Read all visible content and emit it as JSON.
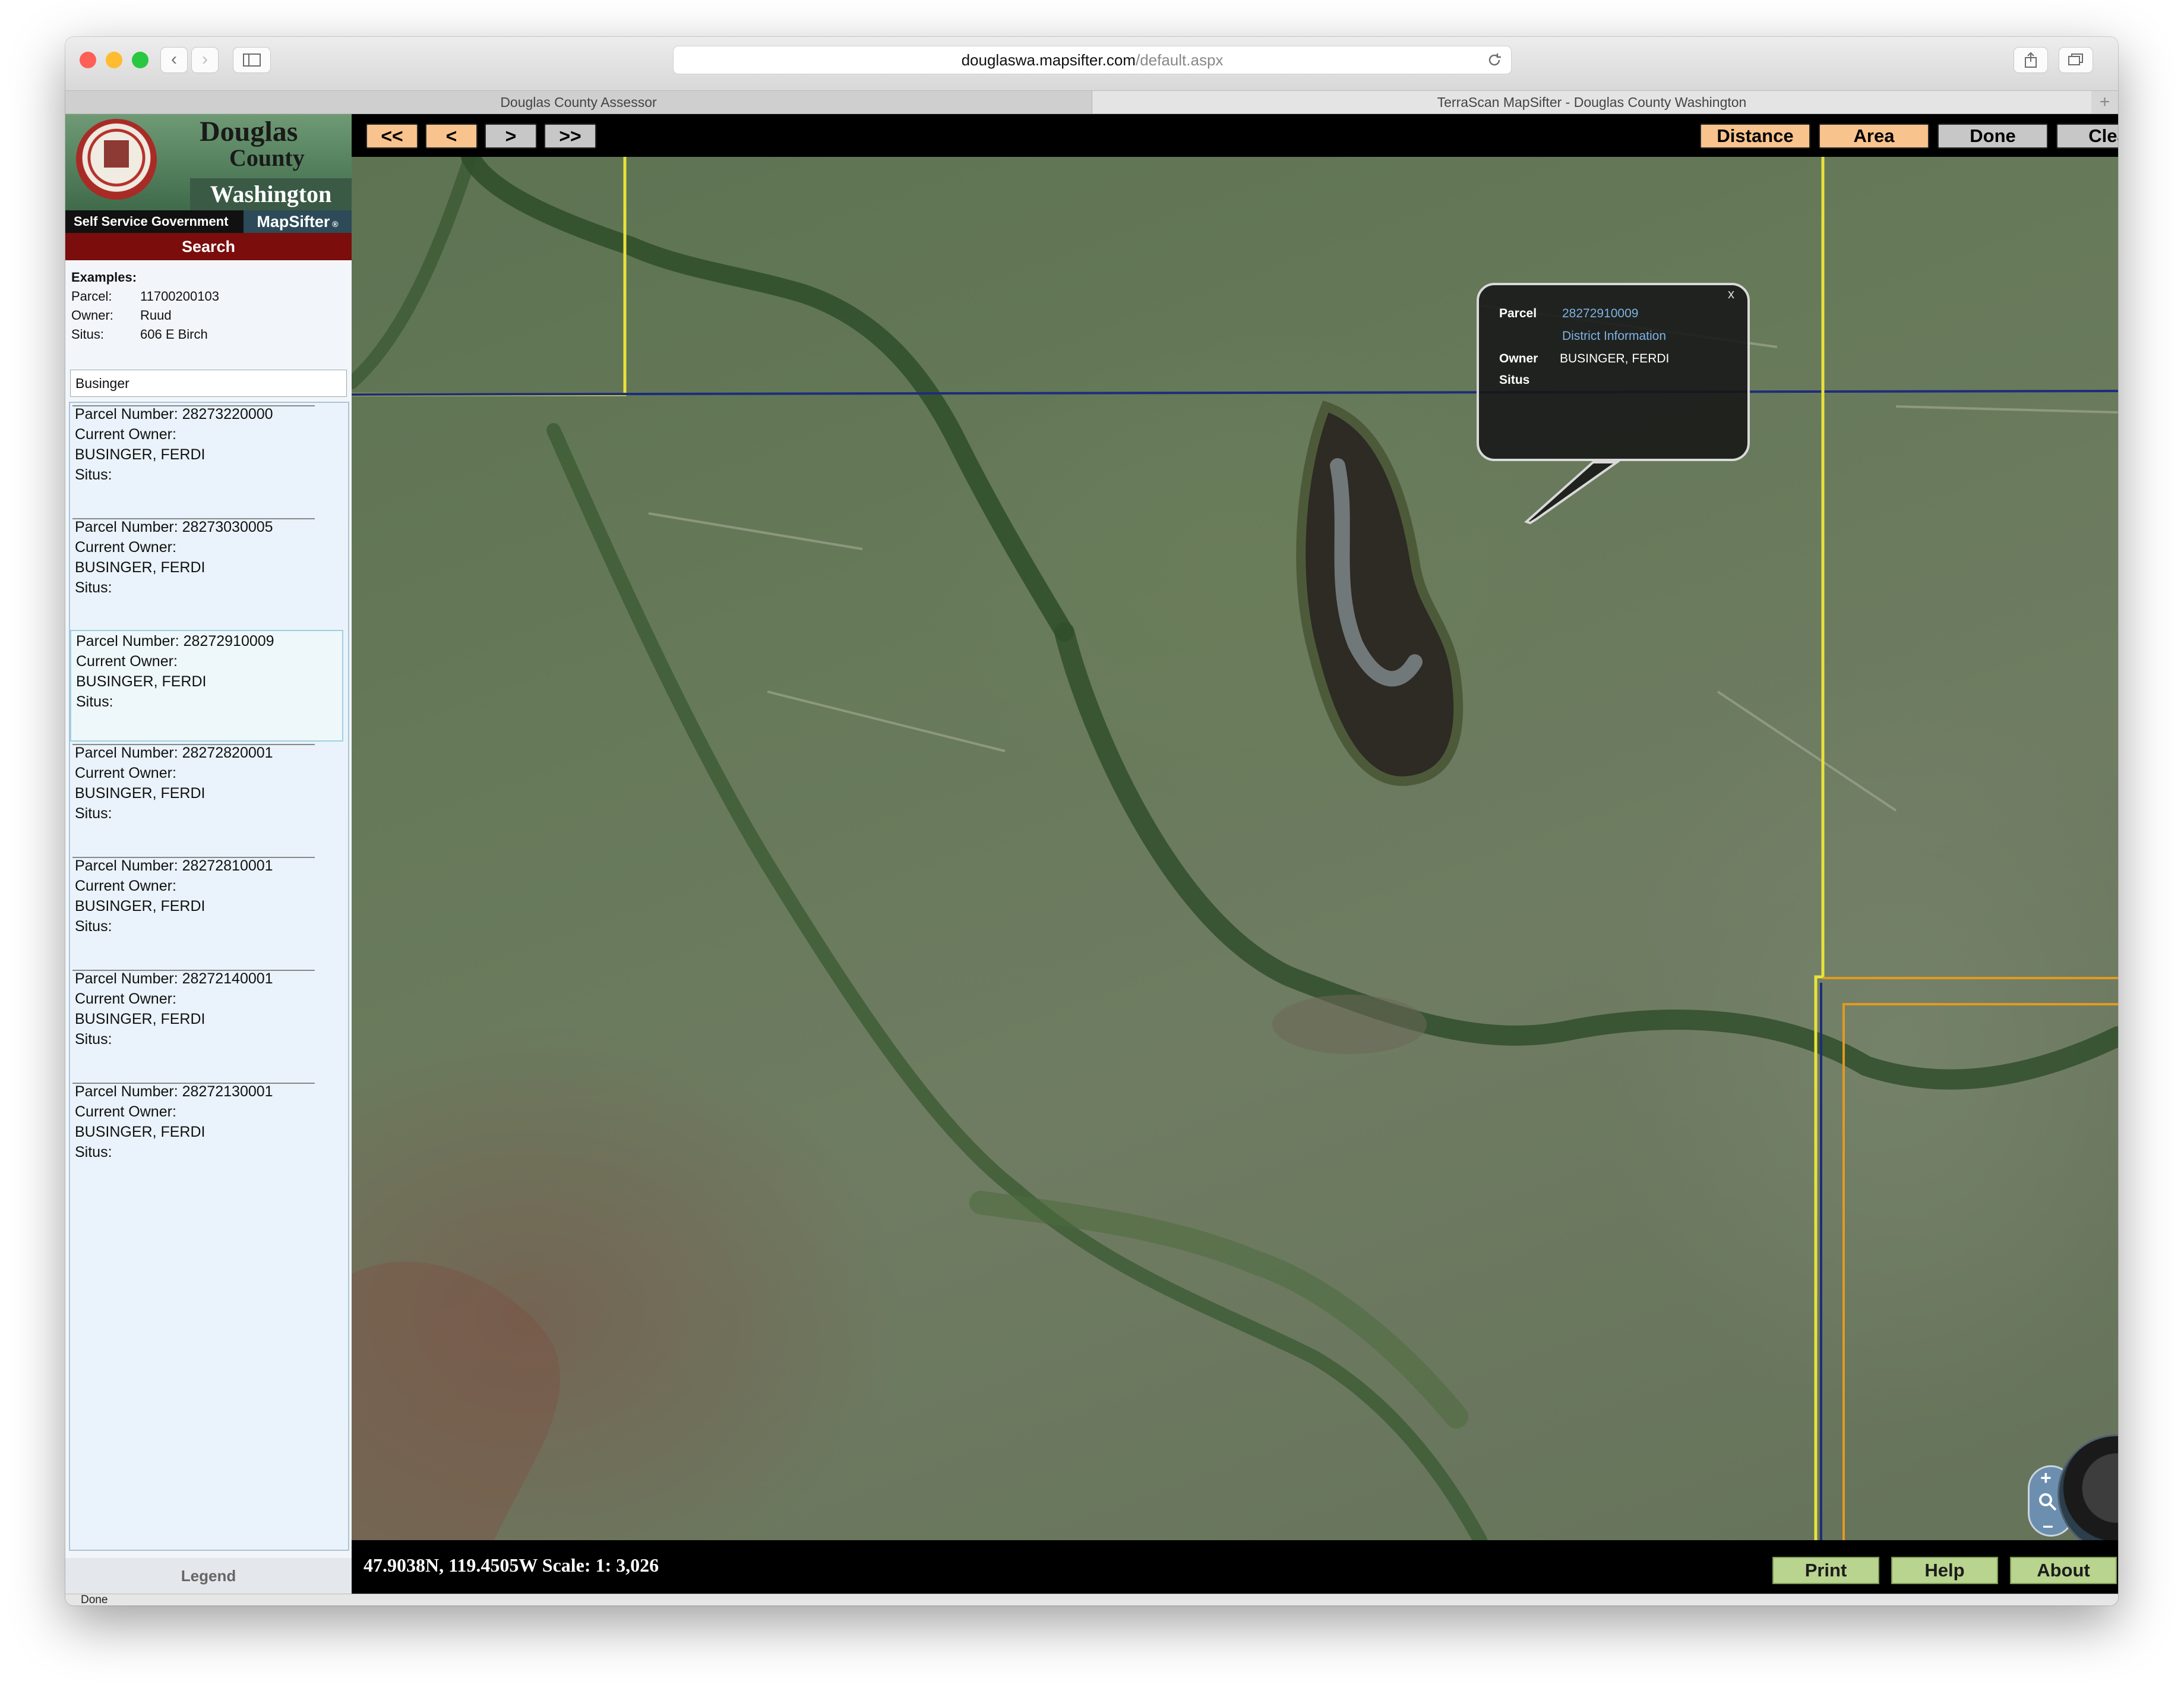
{
  "browser": {
    "url_domain": "douglaswa.mapsifter.com",
    "url_path": "/default.aspx",
    "tabs": [
      {
        "label": "Douglas County Assessor"
      },
      {
        "label": "TerraScan MapSifter - Douglas County Washington"
      }
    ],
    "status": "Done"
  },
  "logo": {
    "title_line1": "Douglas",
    "title_line2": "County",
    "title_line3": "Washington",
    "self_service": "Self Service Government",
    "mapsifter": "MapSifter"
  },
  "sidebar": {
    "search_header": "Search",
    "examples_title": "Examples:",
    "examples": [
      {
        "label": "Parcel:",
        "value": "11700200103"
      },
      {
        "label": "Owner:",
        "value": "Ruud"
      },
      {
        "label": "Situs:",
        "value": "606 E Birch"
      }
    ],
    "search_value": "Businger",
    "legend": "Legend"
  },
  "results": [
    {
      "parcel_line": "Parcel Number: 28273220000",
      "owner_label": "Current Owner:",
      "owner": "BUSINGER, FERDI",
      "situs_label": "Situs:"
    },
    {
      "parcel_line": "Parcel Number: 28273030005",
      "owner_label": "Current Owner:",
      "owner": "BUSINGER, FERDI",
      "situs_label": "Situs:"
    },
    {
      "parcel_line": "Parcel Number: 28272910009",
      "owner_label": "Current Owner:",
      "owner": "BUSINGER, FERDI",
      "situs_label": "Situs:",
      "selected": true
    },
    {
      "parcel_line": "Parcel Number: 28272820001",
      "owner_label": "Current Owner:",
      "owner": "BUSINGER, FERDI",
      "situs_label": "Situs:"
    },
    {
      "parcel_line": "Parcel Number: 28272810001",
      "owner_label": "Current Owner:",
      "owner": "BUSINGER, FERDI",
      "situs_label": "Situs:"
    },
    {
      "parcel_line": "Parcel Number: 28272140001",
      "owner_label": "Current Owner:",
      "owner": "BUSINGER, FERDI",
      "situs_label": "Situs:"
    },
    {
      "parcel_line": "Parcel Number: 28272130001",
      "owner_label": "Current Owner:",
      "owner": "BUSINGER, FERDI",
      "situs_label": "Situs:"
    }
  ],
  "toolbar": {
    "first": "<<",
    "prev": "<",
    "next": ">",
    "last": ">>",
    "distance": "Distance",
    "area": "Area",
    "done": "Done",
    "clear": "Clear"
  },
  "popup": {
    "close": "x",
    "parcel_label": "Parcel",
    "parcel_value": "28272910009",
    "district_link": "District Information",
    "owner_label": "Owner",
    "owner_value": "BUSINGER, FERDI",
    "situs_label": "Situs"
  },
  "footer": {
    "coords": "47.9038N, 119.4505W Scale: 1: 3,026",
    "print": "Print",
    "help": "Help",
    "about": "About"
  },
  "colors": {
    "orange_button": "#f9c38d",
    "gray_button": "#c7c7c7",
    "green_button": "#b9d48e",
    "search_header": "#7b0d0d",
    "parcel_line_yellow": "#e9e23a",
    "parcel_line_blue": "#1e2d7a",
    "parcel_line_orange": "#e39a1e",
    "link_blue": "#7fb1e6"
  },
  "icons": {
    "back": "chevron-left-icon",
    "forward": "chevron-right-icon",
    "sidebar": "sidebar-icon",
    "reload": "reload-icon",
    "share": "share-icon",
    "tabs": "tabs-icon",
    "new_tab": "plus-icon",
    "zoom": "magnifier-icon"
  }
}
